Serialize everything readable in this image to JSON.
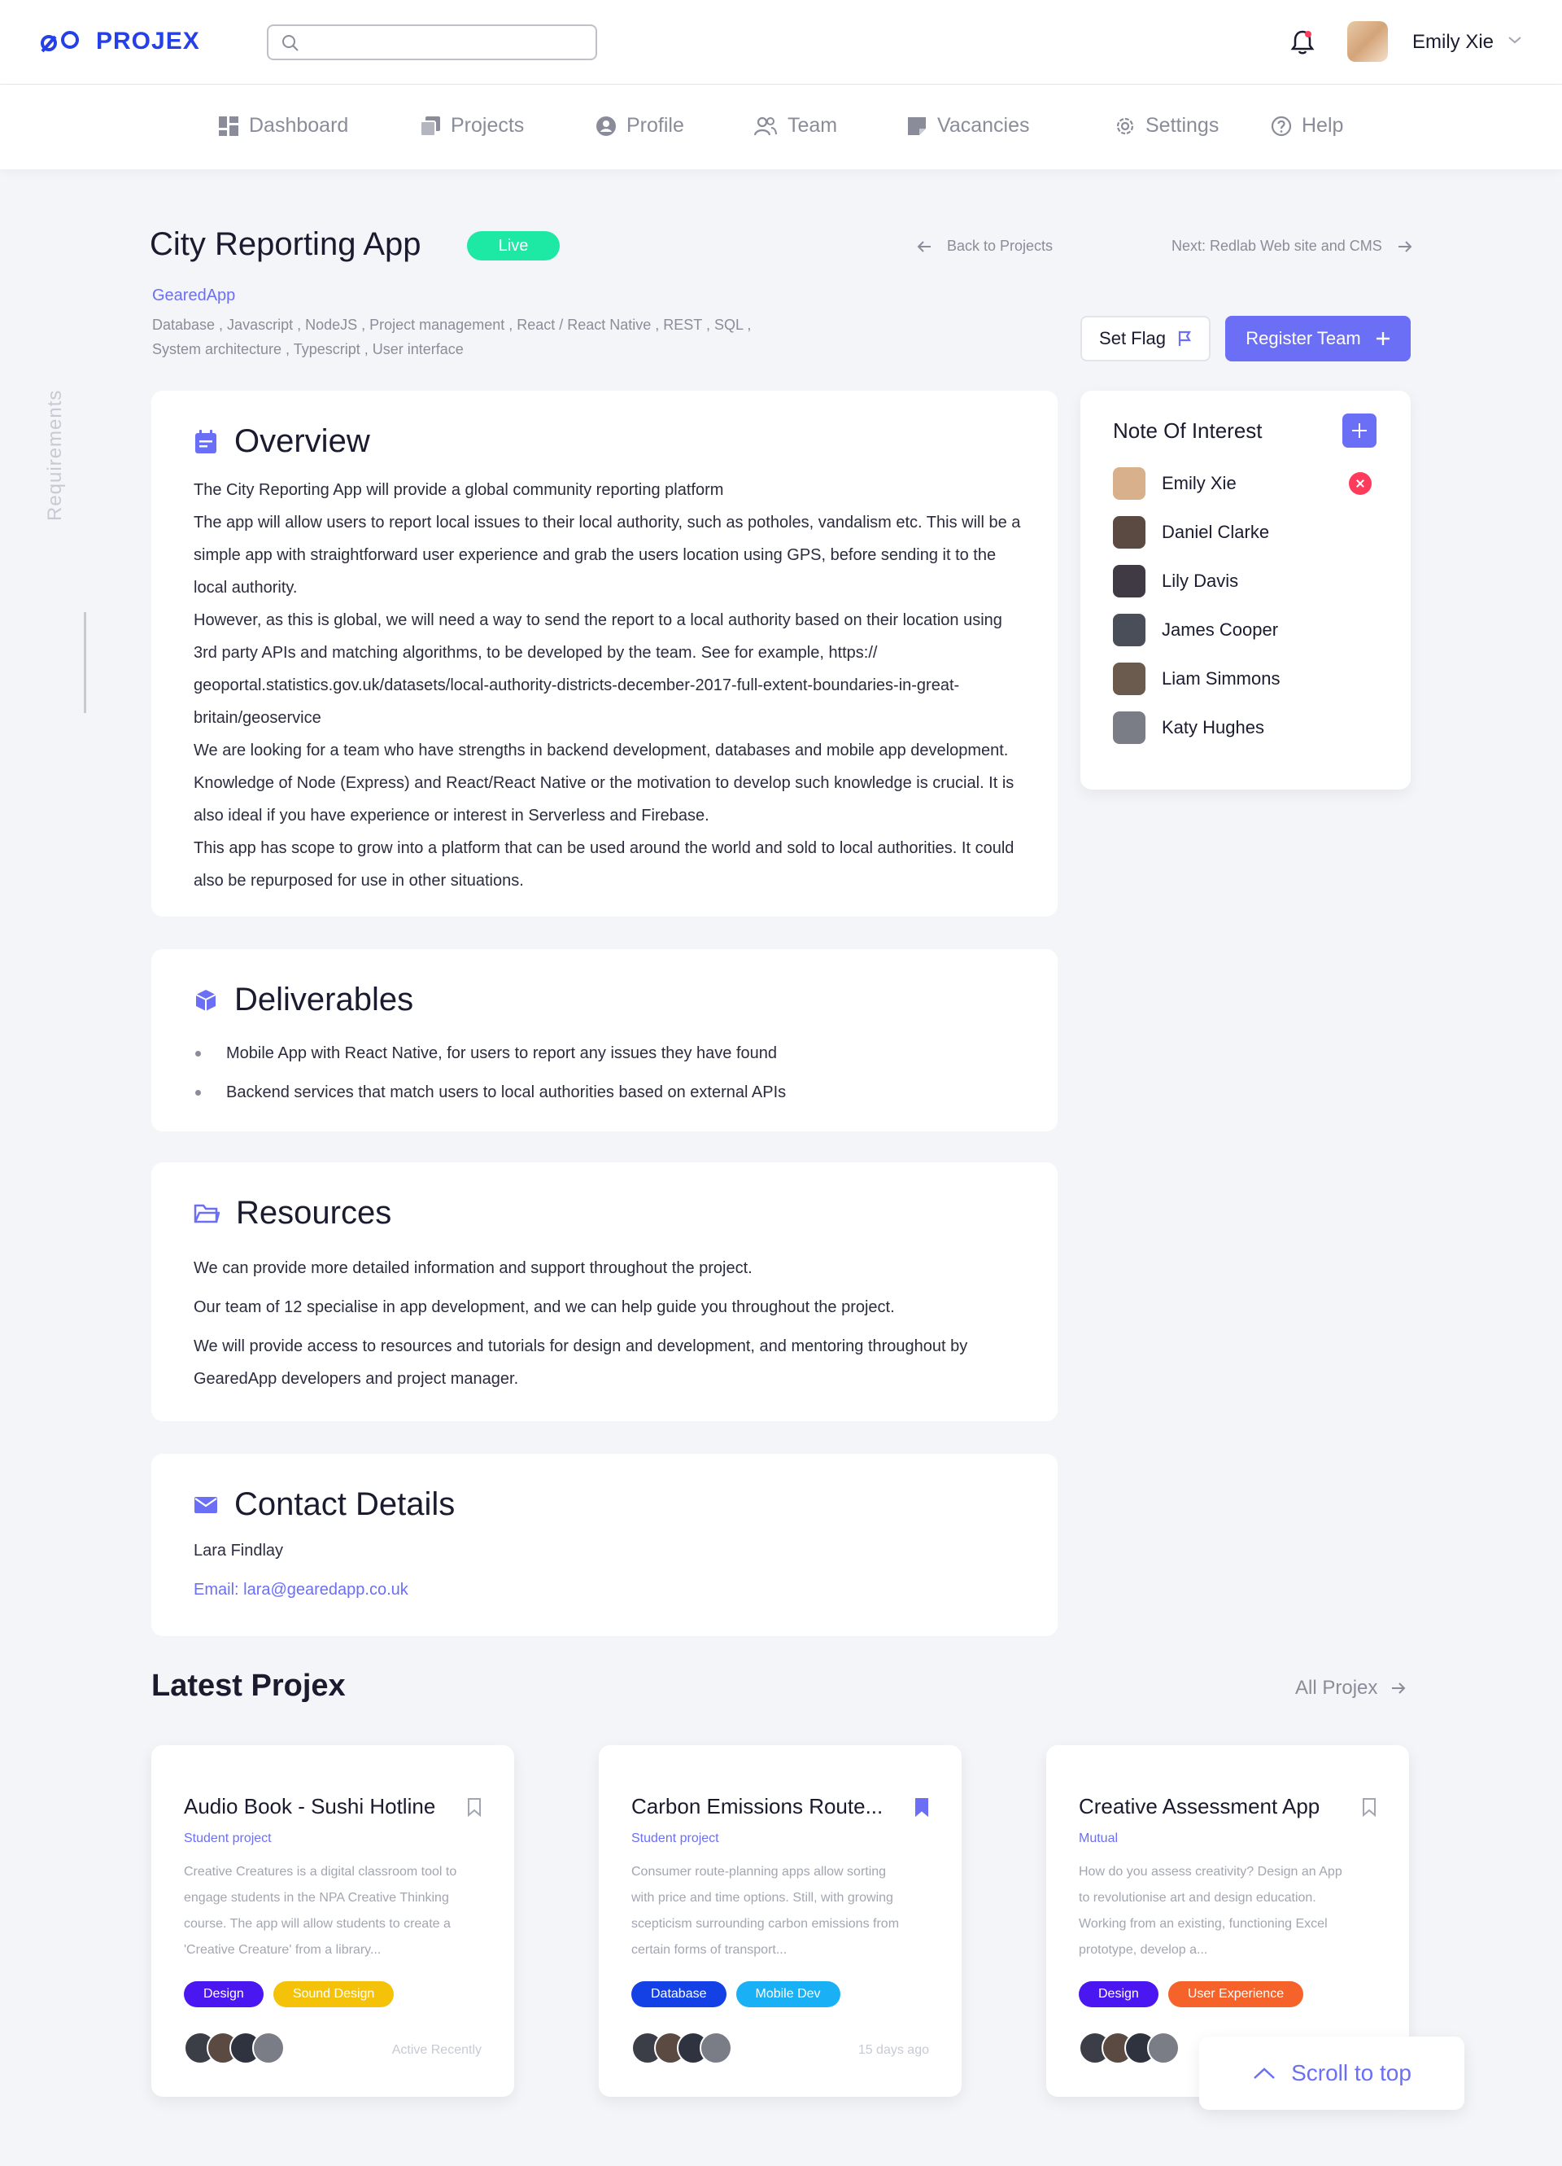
{
  "header": {
    "logo_text": "PROJEX",
    "search_placeholder": "",
    "user_name": "Emily Xie"
  },
  "nav": {
    "items": [
      {
        "label": "Dashboard",
        "icon": "dashboard-icon"
      },
      {
        "label": "Projects",
        "icon": "projects-icon"
      },
      {
        "label": "Profile",
        "icon": "profile-icon"
      },
      {
        "label": "Team",
        "icon": "team-icon"
      },
      {
        "label": "Vacancies",
        "icon": "vacancies-icon"
      },
      {
        "label": "Settings",
        "icon": "gear-icon"
      },
      {
        "label": "Help",
        "icon": "help-icon"
      }
    ]
  },
  "project": {
    "title": "City Reporting App",
    "status": "Live",
    "back_label": "Back to Projects",
    "next_label": "Next: Redlab Web site and CMS",
    "company": "GearedApp",
    "tags_line1": "Database , Javascript , NodeJS , Project management , React / React Native , REST , SQL ,",
    "tags_line2": "System architecture , Typescript , User interface",
    "set_flag_label": "Set Flag",
    "register_label": "Register Team",
    "side_label": "Requirements"
  },
  "overview": {
    "title": "Overview",
    "paragraphs": [
      "The City Reporting App will provide a global community reporting platform",
      "The app will allow users to report local issues to their local authority, such as potholes, vandalism etc. This will be a simple app with straightforward user experience and grab the users location using GPS, before sending it to the local authority.",
      "However, as this is global, we will need a way to send the report to a local authority based on their location using 3rd party APIs and matching algorithms, to be developed by the team. See for example, https:// geoportal.statistics.gov.uk/datasets/local-authority-districts-december-2017-full-extent-boundaries-in-great-britain/geoservice",
      "We are looking for a team who have strengths in backend development, databases and mobile app development. Knowledge of Node (Express) and React/React Native or the motivation to develop such knowledge is crucial. It is also ideal if you have experience or interest in Serverless and Firebase.",
      "This app has scope to grow into a platform that can be used around the world and sold to local authorities. It could also be repurposed for use in other situations."
    ]
  },
  "deliverables": {
    "title": "Deliverables",
    "items": [
      "Mobile App with React Native, for users to report any issues they have found",
      "Backend services that match users to local authorities based on external APIs"
    ]
  },
  "resources": {
    "title": "Resources",
    "paragraphs": [
      "We can provide more detailed information and support throughout the project.",
      "Our team of 12 specialise in app development, and we can help guide you throughout the project.",
      "We will provide access to resources and tutorials for design and development, and mentoring throughout by GearedApp developers and project manager."
    ]
  },
  "contact": {
    "title": "Contact Details",
    "name": "Lara Findlay",
    "email_label": "Email: lara@gearedapp.co.uk"
  },
  "note_of_interest": {
    "title": "Note Of Interest",
    "people": [
      {
        "name": "Emily Xie",
        "color": "#d9b08c"
      },
      {
        "name": "Daniel Clarke",
        "color": "#5a4a42"
      },
      {
        "name": "Lily Davis",
        "color": "#3f3a44"
      },
      {
        "name": "James Cooper",
        "color": "#4a4e58"
      },
      {
        "name": "Liam Simmons",
        "color": "#6b5a4e"
      },
      {
        "name": "Katy Hughes",
        "color": "#7a7d86"
      }
    ]
  },
  "latest": {
    "title": "Latest Projex",
    "all_label": "All Projex",
    "cards": [
      {
        "title": "Audio Book - Sushi Hotline",
        "type": "Student project",
        "desc": "Creative Creatures is a digital classroom tool to engage students in the NPA Creative Thinking course. The app will allow students to create a 'Creative Creature' from a library...",
        "tags": [
          {
            "label": "Design",
            "color": "#4b17f0"
          },
          {
            "label": "Sound Design",
            "color": "#f5c20a"
          }
        ],
        "time": "Active Recently",
        "bookmarked": false
      },
      {
        "title": "Carbon Emissions Route...",
        "type": "Student project",
        "desc": "Consumer route-planning apps allow sorting with price and time options. Still, with growing scepticism surrounding carbon emissions from certain forms of transport...",
        "tags": [
          {
            "label": "Database",
            "color": "#1441e6"
          },
          {
            "label": "Mobile Dev",
            "color": "#1ab0f5"
          }
        ],
        "time": "15 days ago",
        "bookmarked": true
      },
      {
        "title": "Creative Assessment App",
        "type": "Mutual",
        "desc": "How do you assess creativity? Design an App to revolutionise art and design education. Working from an existing, functioning Excel prototype, develop a...",
        "tags": [
          {
            "label": "Design",
            "color": "#4b17f0"
          },
          {
            "label": "User Experience",
            "color": "#f5622a"
          }
        ],
        "time": "",
        "bookmarked": false
      }
    ]
  },
  "scroll_top_label": "Scroll to top",
  "colors": {
    "accent": "#6b6ff5",
    "brand": "#2640e8",
    "live": "#1de8a4",
    "danger": "#ff3b5c"
  }
}
